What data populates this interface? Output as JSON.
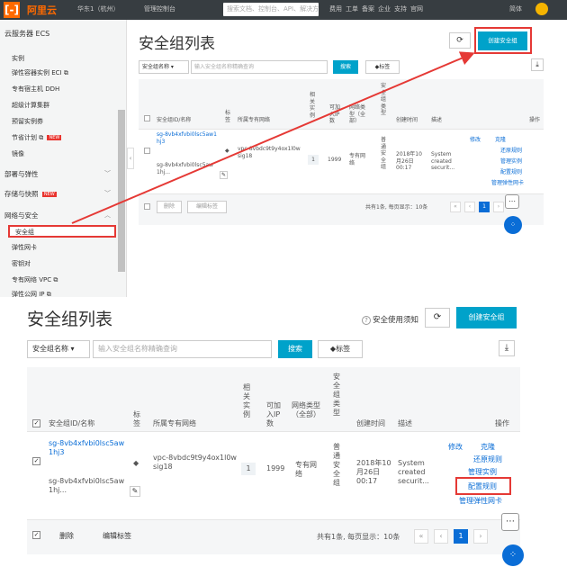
{
  "top": {
    "topbar": {
      "logo_glyph": "[-]",
      "brand": "阿里云",
      "items": [
        "华东1（杭州）",
        "管理控制台",
        "搜索文档、控制台、API、解决方案和资源"
      ],
      "right_items": [
        "费用",
        "工单",
        "备案",
        "企业",
        "支持",
        "官网",
        "简体"
      ]
    },
    "sidebar": {
      "title": "云服务器 ECS",
      "items_instances": [
        "实例",
        "弹性容器实例 ECI ⧉",
        "专有宿主机 DDH",
        "超级计算集群",
        "预留实例券",
        "节省计划 ⧉",
        "镜像"
      ],
      "new_badge": "NEW",
      "groups": [
        "部署与弹性",
        "存储与快照",
        "网络与安全"
      ],
      "network_items": [
        "安全组",
        "弹性网卡",
        "密钥对",
        "专有网络 VPC ⧉",
        "弹性公网 IP ⧉"
      ]
    },
    "main": {
      "title": "安全组列表",
      "refresh_glyph": "⟳",
      "create_label": "创建安全组",
      "filter_select": "安全组名称",
      "search_placeholder": "输入安全组名称精确查询",
      "search_label": "搜索",
      "tag_label": "标签",
      "export_glyph": "⤓",
      "annotation": "名字自动生成"
    }
  },
  "bottom": {
    "title": "安全组列表",
    "notice": "安全使用须知",
    "refresh_glyph": "⟳",
    "create_label": "创建安全组",
    "filter_select": "安全组名称",
    "search_placeholder": "输入安全组名称精确查询",
    "search_label": "搜索",
    "tag_label": "标签",
    "export_glyph": "⤓",
    "table": {
      "headers": {
        "id_name": "安全组ID/名称",
        "tag": "标签",
        "vpc": "所属专有网络",
        "related_instances": "相关实例",
        "ip_available": "可加入IP数",
        "network_type": "网络类型（全部）",
        "group_type": "安全组类型",
        "created": "创建时间",
        "description": "描述",
        "actions": "操作"
      },
      "row": {
        "id": "sg-8vb4xfvbi0lsc5aw1hj3",
        "name": "sg-8vb4xfvbi0lsc5aw1hj...",
        "vpc": "vpc-8vbdc9t9y4ox1l0wsig18",
        "related_instances": "1",
        "ip_available": "1999",
        "network_type": "专有网络",
        "group_type": "普通安全组",
        "created": "2018年10月26日 00:17",
        "description": "System created securit...",
        "actions": {
          "modify": "修改",
          "clone": "克隆",
          "restore": "还原规则",
          "manage_instances": "管理实例",
          "configure_rules": "配置规则",
          "manage_eni": "管理弹性网卡"
        }
      },
      "footer": {
        "delete_label": "删除",
        "edit_tags_label": "编辑标签",
        "pagination_text": "共有1条, 每页显示：10条",
        "current_page": "1"
      }
    }
  }
}
